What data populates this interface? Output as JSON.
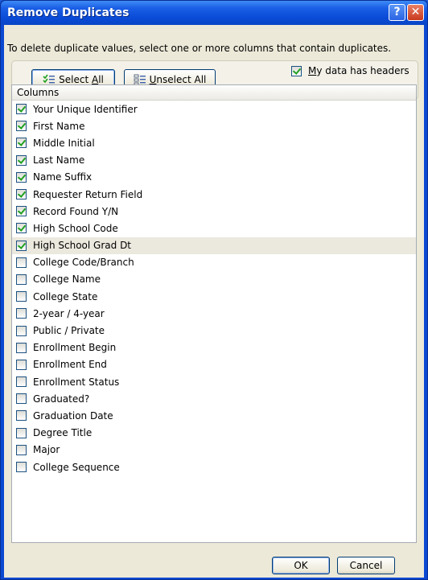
{
  "window": {
    "title": "Remove Duplicates",
    "help_glyph": "?",
    "close_glyph": "✕"
  },
  "description": "To delete duplicate values, select one or more columns that contain duplicates.",
  "buttons": {
    "select_all_prefix": "Select ",
    "select_all_mnemonic": "A",
    "select_all_suffix": "ll",
    "unselect_all_prefix": "",
    "unselect_all_mnemonic": "U",
    "unselect_all_suffix": "nselect All",
    "ok": "OK",
    "cancel": "Cancel"
  },
  "headers_toggle": {
    "mnemonic": "M",
    "label_rest": "y data has headers",
    "checked": true
  },
  "columns_header": "Columns",
  "columns": [
    {
      "label": "Your Unique Identifier",
      "checked": true
    },
    {
      "label": "First Name",
      "checked": true
    },
    {
      "label": "Middle Initial",
      "checked": true
    },
    {
      "label": "Last Name",
      "checked": true
    },
    {
      "label": "Name Suffix",
      "checked": true
    },
    {
      "label": "Requester Return Field",
      "checked": true
    },
    {
      "label": "Record Found Y/N",
      "checked": true
    },
    {
      "label": "High School Code",
      "checked": true
    },
    {
      "label": "High School Grad Dt",
      "checked": true,
      "highlighted": true
    },
    {
      "label": "College Code/Branch",
      "checked": false
    },
    {
      "label": "College Name",
      "checked": false
    },
    {
      "label": "College State",
      "checked": false
    },
    {
      "label": "2-year / 4-year",
      "checked": false
    },
    {
      "label": "Public / Private",
      "checked": false
    },
    {
      "label": "Enrollment Begin",
      "checked": false
    },
    {
      "label": "Enrollment End",
      "checked": false
    },
    {
      "label": "Enrollment Status",
      "checked": false
    },
    {
      "label": "Graduated?",
      "checked": false
    },
    {
      "label": "Graduation Date",
      "checked": false
    },
    {
      "label": "Degree Title",
      "checked": false
    },
    {
      "label": "Major",
      "checked": false
    },
    {
      "label": "College Sequence",
      "checked": false
    }
  ],
  "colors": {
    "titlebar": "#0a4bd7",
    "dialog_bg": "#ece9d8",
    "check_mark": "#21a121"
  }
}
